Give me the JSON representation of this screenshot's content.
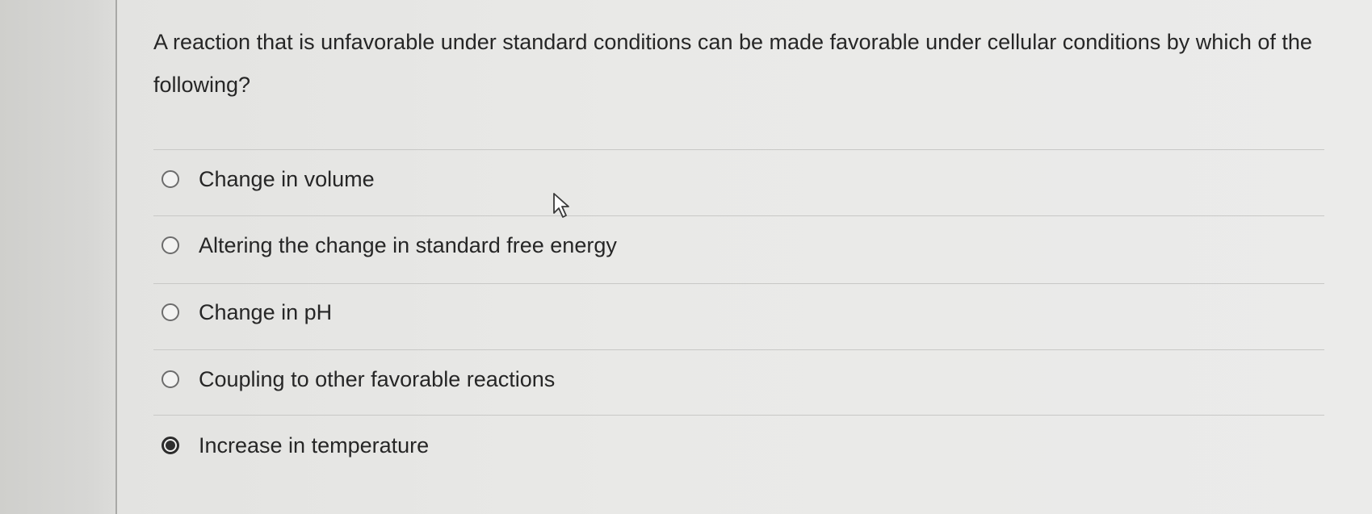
{
  "question": {
    "text": "A reaction that is unfavorable under standard conditions can be made favorable under cellular conditions by which of the following?"
  },
  "options": [
    {
      "label": "Change in volume",
      "selected": false
    },
    {
      "label": "Altering the change in standard free energy",
      "selected": false
    },
    {
      "label": "Change in pH",
      "selected": false
    },
    {
      "label": "Coupling to other favorable reactions",
      "selected": false
    },
    {
      "label": "Increase in temperature",
      "selected": true
    }
  ],
  "icons": {
    "radio_unselected": "radio-empty-icon",
    "radio_selected": "radio-filled-icon",
    "cursor": "mouse-pointer-icon"
  },
  "colors": {
    "background": "#e9e9e7",
    "text": "#262626",
    "divider": "#c8c8c6"
  }
}
